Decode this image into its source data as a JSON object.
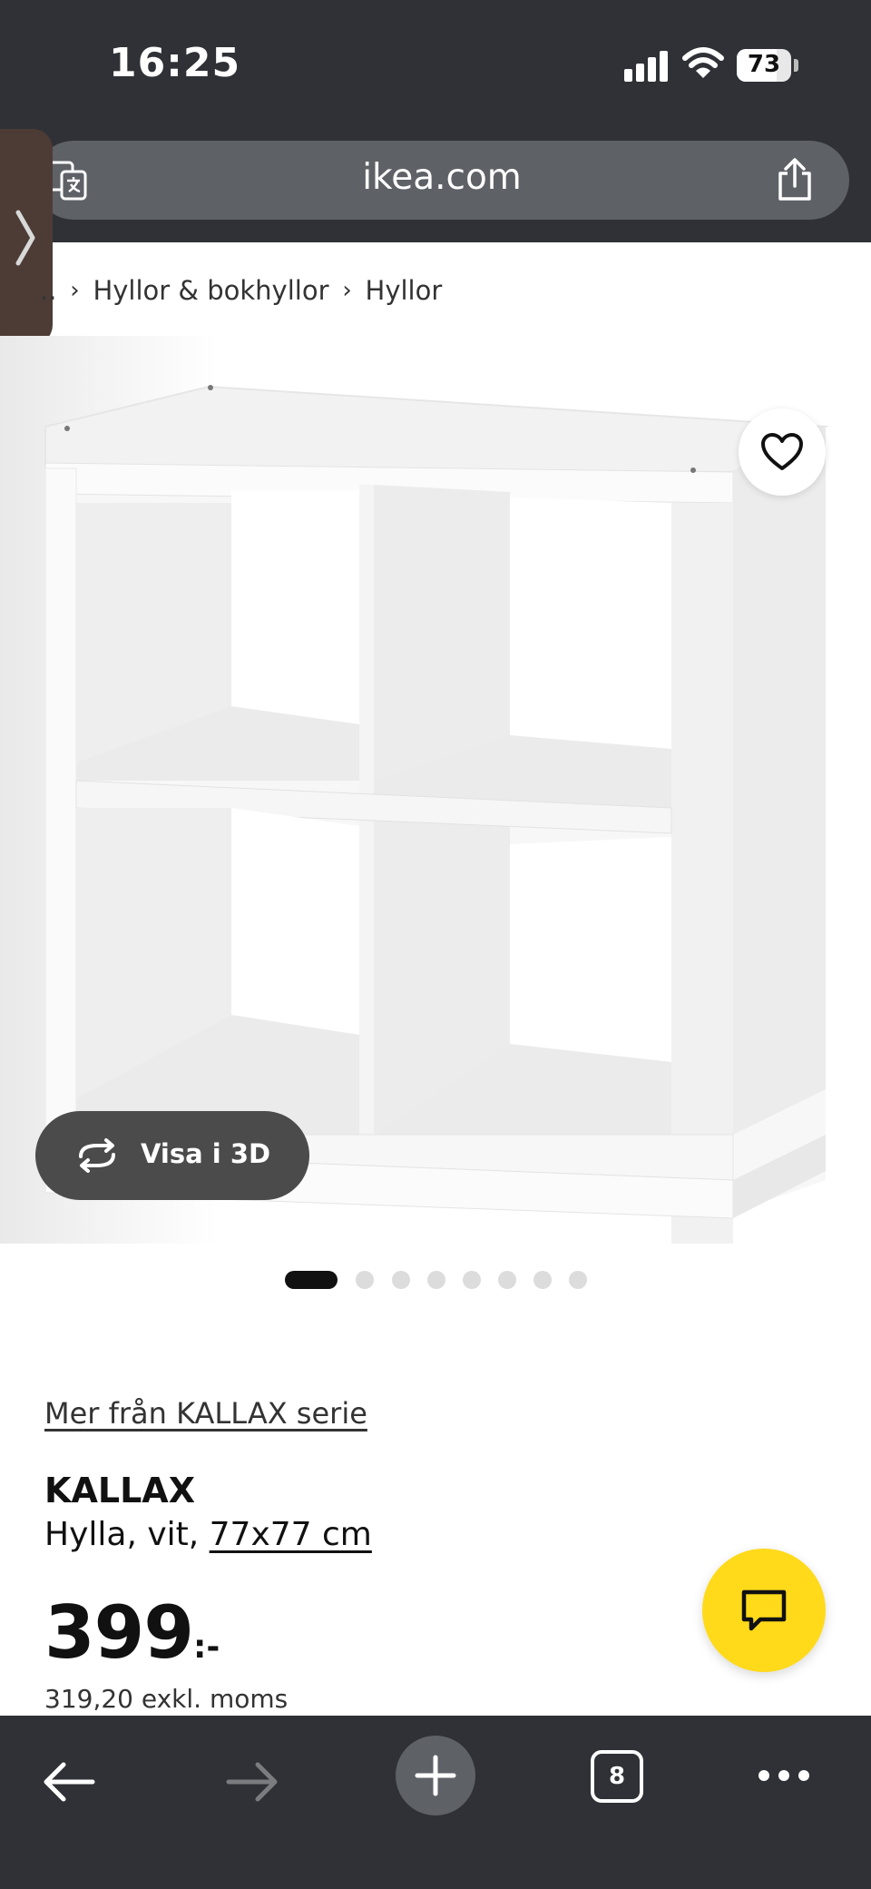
{
  "status_bar": {
    "time": "16:25",
    "battery": "73",
    "icons": [
      "signal-icon",
      "wifi-icon",
      "battery-icon"
    ]
  },
  "browser": {
    "url": "ikea.com",
    "open_tabs": "8",
    "icons": [
      "translate-icon",
      "share-icon",
      "back-arrow-icon",
      "forward-arrow-icon",
      "plus-icon",
      "more-icon"
    ]
  },
  "breadcrumb": {
    "items": [
      "..",
      "Hyllor & bokhyllor",
      "Hyllor"
    ]
  },
  "product": {
    "image_dots": 8,
    "active_dot": 0,
    "view_3d_label": "Visa i 3D",
    "series_link": "Mer från KALLAX serie",
    "name": "KALLAX",
    "description_prefix": "Hylla, vit, ",
    "size": "77x77 cm",
    "price": "399",
    "price_suffix": ":-",
    "price_ex_vat": "319,20 exkl. moms"
  },
  "colors": {
    "chrome": "#2f3136",
    "url_pill": "#5e6166",
    "chat_button": "#ffda1a",
    "view_3d_button": "#4b4b4b"
  }
}
